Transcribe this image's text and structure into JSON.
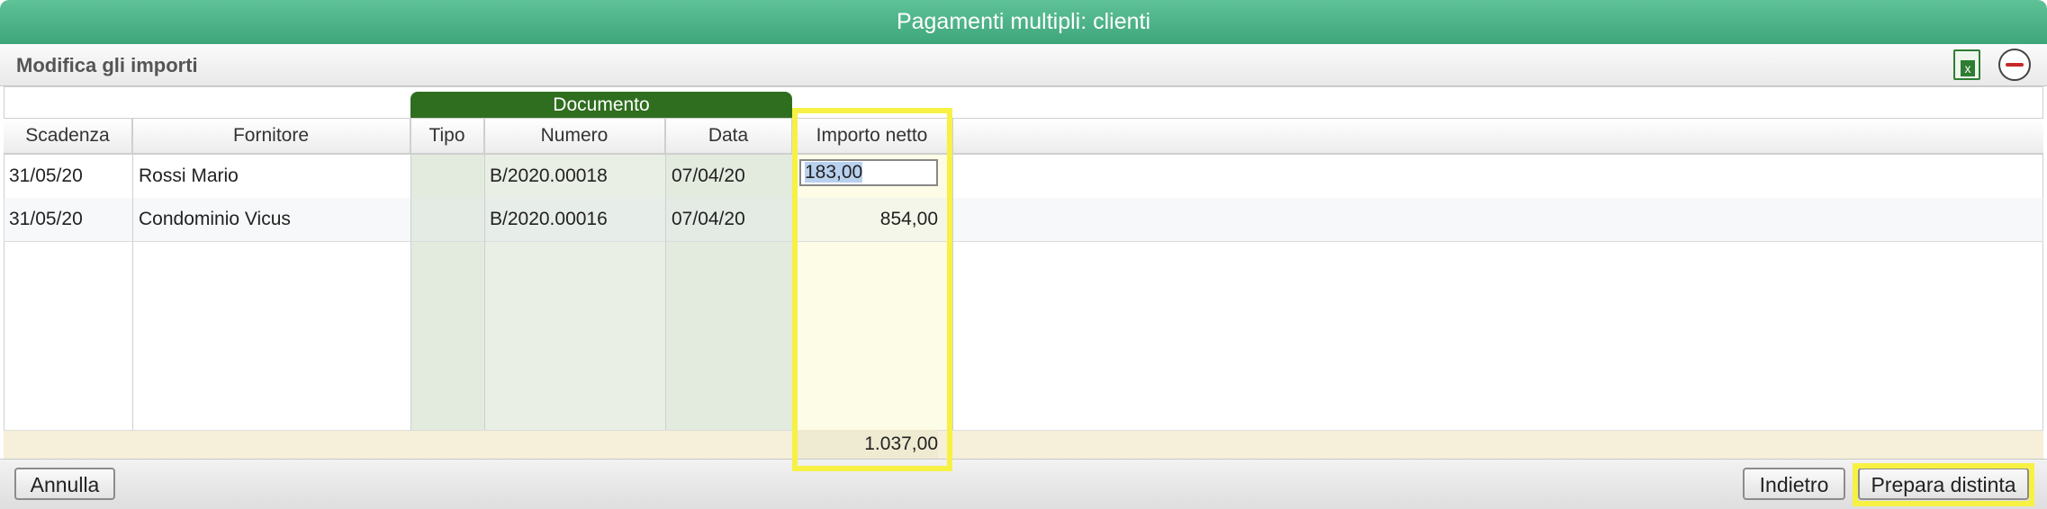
{
  "window": {
    "title": "Pagamenti multipli: clienti"
  },
  "toolbar": {
    "subtitle": "Modifica gli importi",
    "export_icon": "excel-icon",
    "remove_icon": "remove-icon",
    "export_glyph": "x"
  },
  "table": {
    "group_header": "Documento",
    "columns": [
      "Scadenza",
      "Fornitore",
      "Tipo",
      "Numero",
      "Data",
      "Importo netto"
    ],
    "rows": [
      {
        "scadenza": "31/05/20",
        "fornitore": "Rossi Mario",
        "tipo": "",
        "numero": "B/2020.00018",
        "data": "07/04/20",
        "importo": "183,00"
      },
      {
        "scadenza": "31/05/20",
        "fornitore": "Condominio Vicus",
        "tipo": "",
        "numero": "B/2020.00016",
        "data": "07/04/20",
        "importo": "854,00"
      }
    ],
    "total": "1.037,00"
  },
  "footer": {
    "cancel": "Annulla",
    "back": "Indietro",
    "prepare": "Prepara distinta"
  },
  "colors": {
    "title_green": "#3ea57a",
    "doc_header": "#2f6e1f",
    "highlight": "#f7f144"
  }
}
